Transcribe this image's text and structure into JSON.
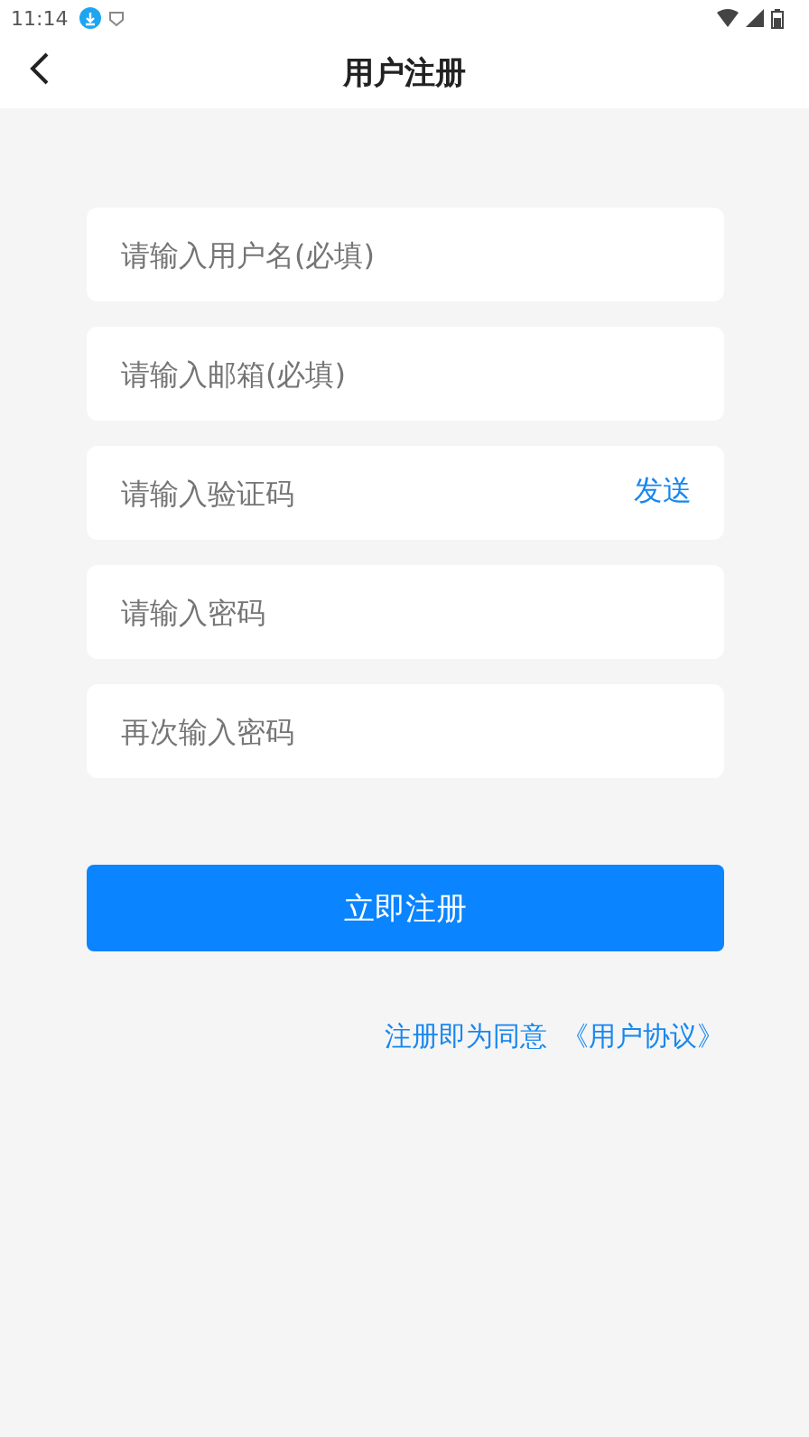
{
  "status_bar": {
    "time": "11:14"
  },
  "header": {
    "title": "用户注册"
  },
  "fields": [
    {
      "placeholder": "请输入用户名(必填)",
      "kind": "text"
    },
    {
      "placeholder": "请输入邮箱(必填)",
      "kind": "text"
    },
    {
      "placeholder": "请输入验证码",
      "kind": "code",
      "action": "发送"
    },
    {
      "placeholder": "请输入密码",
      "kind": "password"
    },
    {
      "placeholder": "再次输入密码",
      "kind": "password"
    }
  ],
  "submit_button": "立即注册",
  "agreement": {
    "text": "注册即为同意",
    "link": "《用户协议》"
  }
}
